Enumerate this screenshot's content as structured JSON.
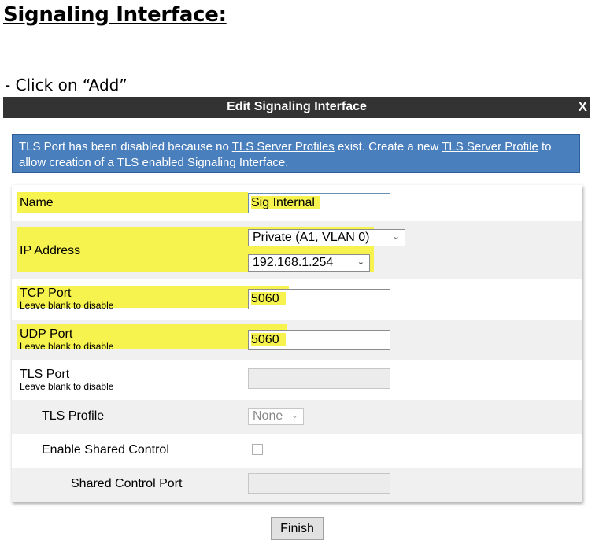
{
  "document": {
    "heading": "Signaling Interface:",
    "step": "- Click on “Add”"
  },
  "dialog": {
    "title": "Edit Signaling Interface",
    "close_label": "X",
    "notice": {
      "part1": "TLS Port has been disabled because no ",
      "link1": "TLS Server Profiles",
      "part2": " exist. Create a new ",
      "link2": "TLS Server Profile",
      "part3": " to allow creation of a TLS enabled Signaling Interface."
    },
    "fields": {
      "name": {
        "label": "Name",
        "value": "Sig Internal"
      },
      "ip_address": {
        "label": "IP Address",
        "interface_value": "Private (A1, VLAN 0)",
        "ip_value": "192.168.1.254"
      },
      "tcp_port": {
        "label": "TCP Port",
        "hint": "Leave blank to disable",
        "value": "5060"
      },
      "udp_port": {
        "label": "UDP Port",
        "hint": "Leave blank to disable",
        "value": "5060"
      },
      "tls_port": {
        "label": "TLS Port",
        "hint": "Leave blank to disable",
        "value": ""
      },
      "tls_profile": {
        "label": "TLS Profile",
        "value": "None"
      },
      "enable_shared_control": {
        "label": "Enable Shared Control",
        "checked": false
      },
      "shared_control_port": {
        "label": "Shared Control Port",
        "value": ""
      }
    },
    "finish_label": "Finish"
  },
  "colors": {
    "header_bg": "#333333",
    "notice_bg": "#4a7fbd",
    "highlight": "#f6f24e",
    "alt_row": "#f0f0f0"
  }
}
